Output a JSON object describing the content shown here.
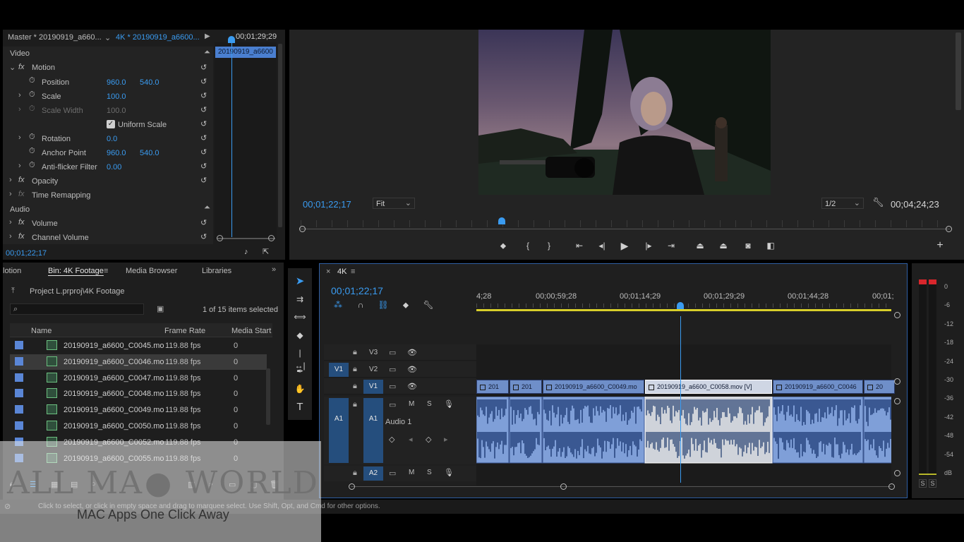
{
  "effect_controls": {
    "master_label": "Master * 20190919_a660...",
    "sequence_label": "4K * 20190919_a6600...",
    "mini_timecode": "00;01;29;29",
    "mini_clip_label": "20190919_a6600",
    "section_video": "Video",
    "motion": "Motion",
    "position": {
      "label": "Position",
      "x": "960.0",
      "y": "540.0"
    },
    "scale": {
      "label": "Scale",
      "value": "100.0"
    },
    "scale_width": {
      "label": "Scale Width",
      "value": "100.0"
    },
    "uniform_scale": "Uniform Scale",
    "rotation": {
      "label": "Rotation",
      "value": "0.0"
    },
    "anchor_point": {
      "label": "Anchor Point",
      "x": "960.0",
      "y": "540.0"
    },
    "anti_flicker": {
      "label": "Anti-flicker Filter",
      "value": "0.00"
    },
    "opacity": "Opacity",
    "time_remapping": "Time Remapping",
    "section_audio": "Audio",
    "volume": "Volume",
    "channel_volume": "Channel Volume",
    "bottom_timecode": "00;01;22;17"
  },
  "program_monitor": {
    "current_timecode": "00;01;22;17",
    "fit_label": "Fit",
    "resolution": "1/2",
    "duration": "00;04;24;23"
  },
  "project": {
    "tabs": [
      "lotion",
      "Bin: 4K Footage",
      "Media Browser",
      "Libraries"
    ],
    "path": "Project L.prproj\\4K Footage",
    "selection_status": "1 of 15 items selected",
    "columns": [
      "Name",
      "Frame Rate",
      "Media Start"
    ],
    "items": [
      {
        "name": "20190919_a6600_C0045.mo",
        "fps": "119.88 fps",
        "start": "0",
        "selected": false
      },
      {
        "name": "20190919_a6600_C0046.mo",
        "fps": "119.88 fps",
        "start": "0",
        "selected": true
      },
      {
        "name": "20190919_a6600_C0047.mo",
        "fps": "119.88 fps",
        "start": "0",
        "selected": false
      },
      {
        "name": "20190919_a6600_C0048.mo",
        "fps": "119.88 fps",
        "start": "0",
        "selected": false
      },
      {
        "name": "20190919_a6600_C0049.mo",
        "fps": "119.88 fps",
        "start": "0",
        "selected": false
      },
      {
        "name": "20190919_a6600_C0050.mo",
        "fps": "119.88 fps",
        "start": "0",
        "selected": false
      },
      {
        "name": "20190919_a6600_C0052.mo",
        "fps": "119.88 fps",
        "start": "0",
        "selected": false
      },
      {
        "name": "20190919_a6600_C0055.mo",
        "fps": "119.88 fps",
        "start": "0",
        "selected": false
      }
    ]
  },
  "timeline": {
    "sequence_name": "4K",
    "current_timecode": "00;01;22;17",
    "ruler": [
      "4;28",
      "00;00;59;28",
      "00;01;14;29",
      "00;01;29;29",
      "00;01;44;28",
      "00;01;"
    ],
    "tracks": {
      "v3": "V3",
      "v2": "V2",
      "v1": "V1",
      "source_v1": "V1",
      "a1": "A1",
      "source_a1": "A1",
      "a2": "A2",
      "mute": "M",
      "solo": "S",
      "a1_name": "Audio 1"
    },
    "video_clips": [
      {
        "label": "201",
        "selected": false
      },
      {
        "label": "201",
        "selected": false
      },
      {
        "label": "20190919_a6600_C0049.mo",
        "selected": false
      },
      {
        "label": "20190919_a6600_C0058.mov [V]",
        "selected": true
      },
      {
        "label": "20190919_a6600_C0046",
        "selected": false
      },
      {
        "label": "20",
        "selected": false
      }
    ]
  },
  "audio_meter": {
    "scale": [
      "0",
      "-6",
      "-12",
      "-18",
      "-24",
      "-30",
      "-36",
      "-42",
      "-48",
      "-54",
      "dB"
    ],
    "solo_left": "S",
    "solo_right": "S"
  },
  "status_bar": {
    "message": "Click to select, or click in empty space and drag to marquee select. Use Shift, Opt, and Cmd for other options."
  },
  "watermark": {
    "left": "ALL MA",
    "right": " WORLD",
    "tagline": "MAC Apps One Click Away"
  },
  "colors": {
    "accent": "#3a9bf0",
    "clip_video": "#6f8fc9",
    "clip_selected": "#cfd6e4",
    "work_area": "#d8cf2a",
    "meter_clip": "#d8262c"
  }
}
